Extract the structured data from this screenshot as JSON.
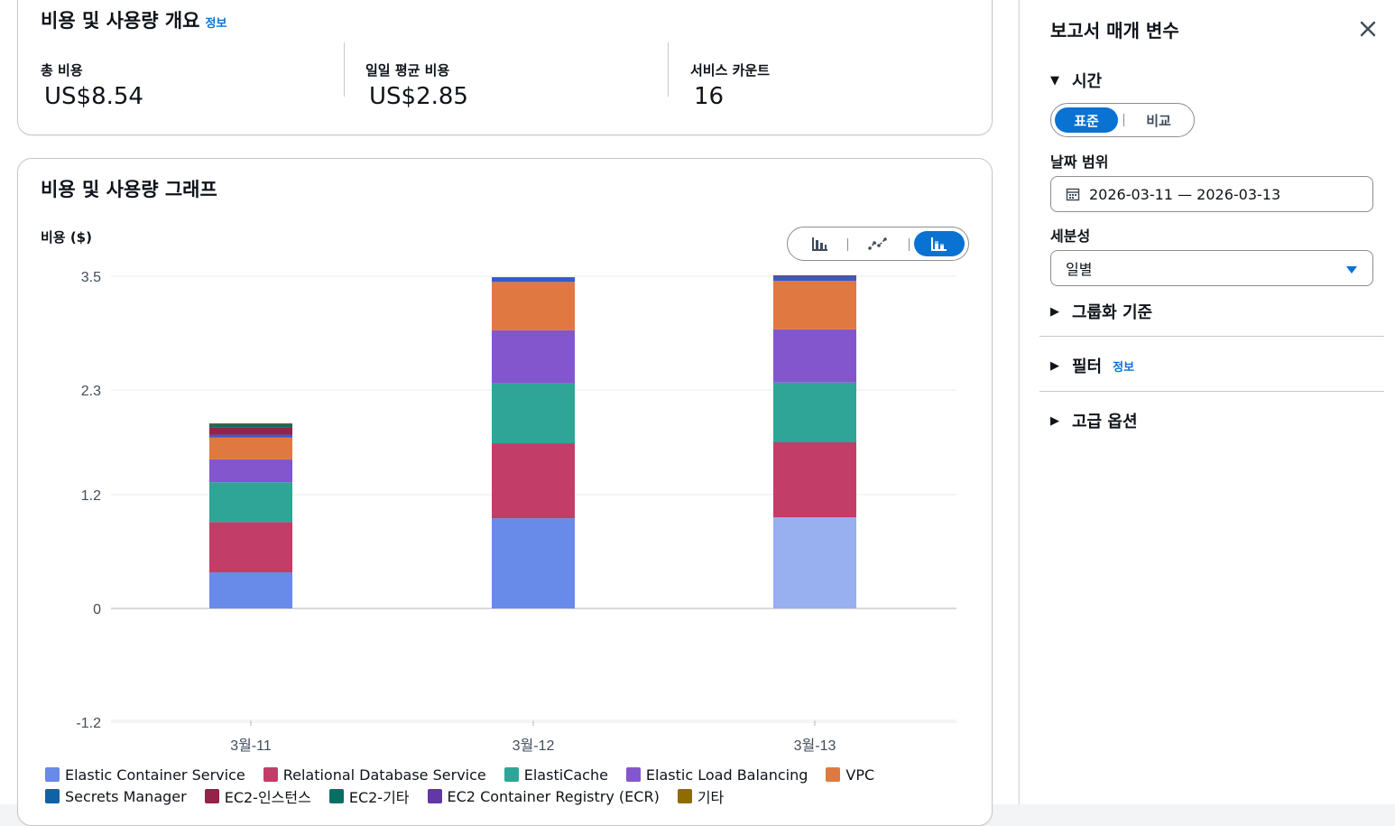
{
  "overview": {
    "title": "비용 및 사용량 개요",
    "info": "정보",
    "metrics": [
      {
        "label": "총 비용",
        "value": "US$8.54"
      },
      {
        "label": "일일 평균 비용",
        "value": "US$2.85"
      },
      {
        "label": "서비스 카운트",
        "value": "16"
      }
    ]
  },
  "graph": {
    "title": "비용 및 사용량 그래프",
    "view_toggle": [
      "bar-chart-icon",
      "line-chart-icon",
      "stacked-bar-chart-icon"
    ]
  },
  "chart_data": {
    "type": "bar",
    "stacked": true,
    "ylabel": "비용 ($)",
    "xlabel": "",
    "ylim": [
      -1.2,
      3.5
    ],
    "yticks": [
      "3.5",
      "2.3",
      "1.2",
      "0",
      "-1.2"
    ],
    "ytick_values": [
      3.5,
      2.3,
      1.2,
      0,
      -1.2
    ],
    "categories": [
      "3월-11",
      "3월-12",
      "3월-13"
    ],
    "series": [
      {
        "name": "Elastic Container Service",
        "color": "#688ae8",
        "values": [
          0.38,
          0.95,
          0.96
        ]
      },
      {
        "name": "Relational Database Service",
        "color": "#c33d69",
        "values": [
          0.53,
          0.79,
          0.79
        ]
      },
      {
        "name": "ElastiCache",
        "color": "#2ea597",
        "values": [
          0.42,
          0.63,
          0.63
        ]
      },
      {
        "name": "Elastic Load Balancing",
        "color": "#8456ce",
        "values": [
          0.24,
          0.56,
          0.56
        ]
      },
      {
        "name": "VPC",
        "color": "#e07941",
        "values": [
          0.23,
          0.51,
          0.51
        ]
      },
      {
        "name": "Secrets Manager",
        "color": "#3759ce",
        "values": [
          0.03,
          0.05,
          0.05
        ]
      },
      {
        "name": "EC2-인스턴스",
        "color": "#962249",
        "values": [
          0.08,
          0.0,
          0.0
        ]
      },
      {
        "name": "EC2-기타",
        "color": "#096f64",
        "values": [
          0.03,
          0.0,
          0.0
        ]
      },
      {
        "name": "EC2 Container Registry (ECR)",
        "color": "#6237a7",
        "values": [
          0.0,
          0.0,
          0.0
        ]
      },
      {
        "name": "기타",
        "color": "#a84401",
        "values": [
          0.01,
          0.0,
          0.01
        ]
      }
    ],
    "legend_position": "bottom",
    "grid": true
  },
  "legend_rows": [
    [
      0,
      1,
      2,
      3,
      4
    ],
    [
      5,
      6,
      7,
      8,
      9
    ]
  ],
  "panel": {
    "title": "보고서 매개 변수",
    "time_section": "시간",
    "toggle": {
      "standard": "표준",
      "compare": "비교"
    },
    "date_range_label": "날짜 범위",
    "date_range_value": "2026-03-11 — 2026-03-13",
    "granularity_label": "세분성",
    "granularity_value": "일별",
    "group_by": "그룹화 기준",
    "filter": "필터",
    "filter_info": "정보",
    "advanced": "고급 옵션"
  },
  "colors": {
    "accent": "#0972d3",
    "legend_secrets": "#0f61a8",
    "legend_ec2_inst": "#962249",
    "legend_ec2_other": "#096f64",
    "legend_ecr": "#6237a7",
    "legend_other": "#8f6c00"
  }
}
